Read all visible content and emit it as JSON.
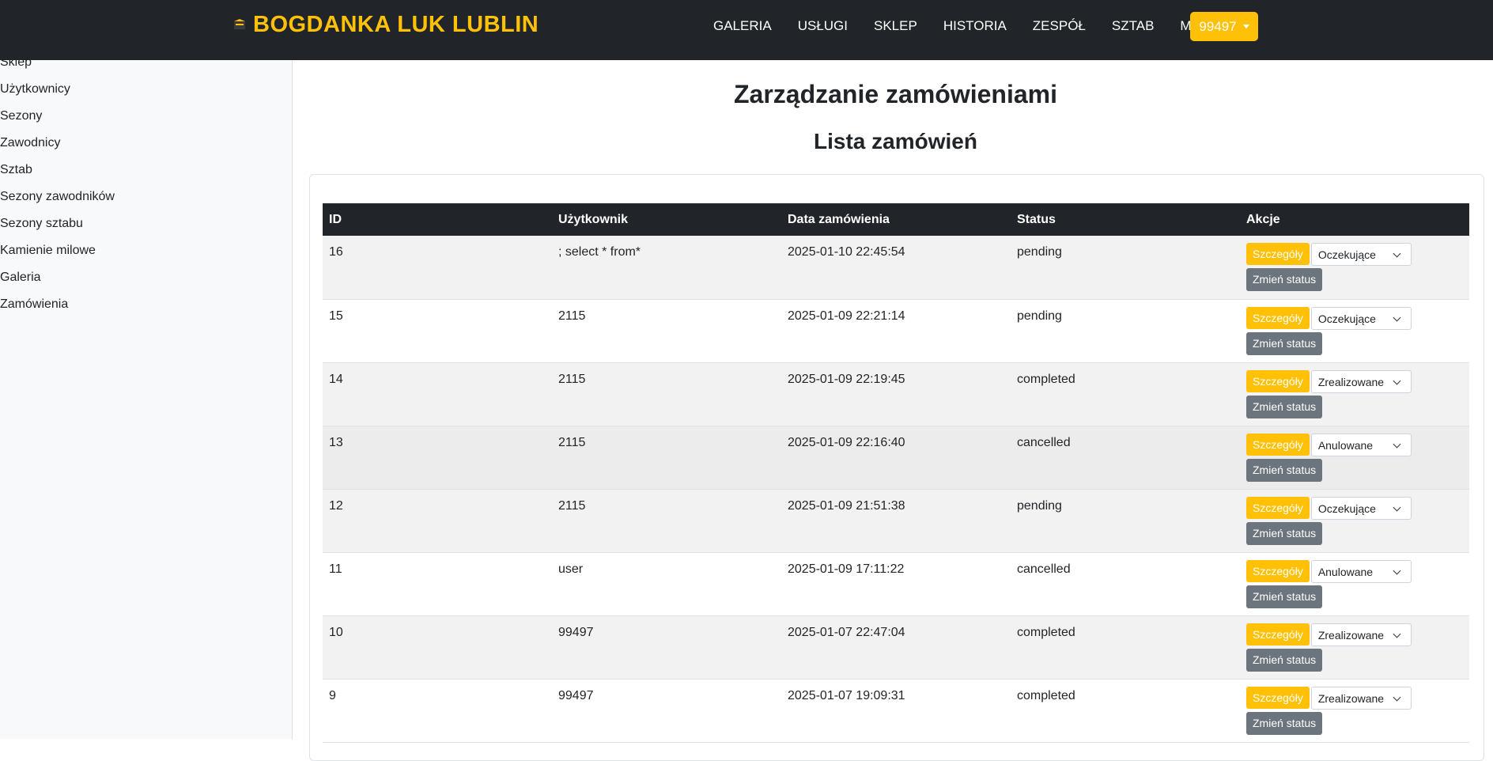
{
  "navbar": {
    "brand": "BOGDANKA LUK LUBLIN",
    "logo_icon": "club-logo-icon",
    "links": [
      "GALERIA",
      "USŁUGI",
      "SKLEP",
      "HISTORIA",
      "ZESPÓŁ",
      "SZTAB",
      "MAPA"
    ],
    "user": "99497",
    "accent": "#ffc107",
    "background": "#212529"
  },
  "sidebar": {
    "items": [
      "Sklep",
      "Użytkownicy",
      "Sezony",
      "Zawodnicy",
      "Sztab",
      "Sezony zawodników",
      "Sezony sztabu",
      "Kamienie milowe",
      "Galeria",
      "Zamówienia"
    ]
  },
  "main": {
    "title": "Zarządzanie zamówieniami",
    "section_title": "Lista zamówień"
  },
  "table": {
    "headers": [
      "ID",
      "Użytkownik",
      "Data zamówienia",
      "Status",
      "Akcje"
    ],
    "details_label": "Szczegóły",
    "change_label": "Zmień status",
    "rows": [
      {
        "id": "16",
        "user": "; select * from*",
        "date": "2025-01-10 22:45:54",
        "status": "pending",
        "select": "Oczekujące"
      },
      {
        "id": "15",
        "user": "2115",
        "date": "2025-01-09 22:21:14",
        "status": "pending",
        "select": "Oczekujące"
      },
      {
        "id": "14",
        "user": "2115",
        "date": "2025-01-09 22:19:45",
        "status": "completed",
        "select": "Zrealizowane"
      },
      {
        "id": "13",
        "user": "2115",
        "date": "2025-01-09 22:16:40",
        "status": "cancelled",
        "select": "Anulowane"
      },
      {
        "id": "12",
        "user": "2115",
        "date": "2025-01-09 21:51:38",
        "status": "pending",
        "select": "Oczekujące"
      },
      {
        "id": "11",
        "user": "user",
        "date": "2025-01-09 17:11:22",
        "status": "cancelled",
        "select": "Anulowane"
      },
      {
        "id": "10",
        "user": "99497",
        "date": "2025-01-07 22:47:04",
        "status": "completed",
        "select": "Zrealizowane"
      },
      {
        "id": "9",
        "user": "99497",
        "date": "2025-01-07 19:09:31",
        "status": "completed",
        "select": "Zrealizowane"
      }
    ]
  }
}
